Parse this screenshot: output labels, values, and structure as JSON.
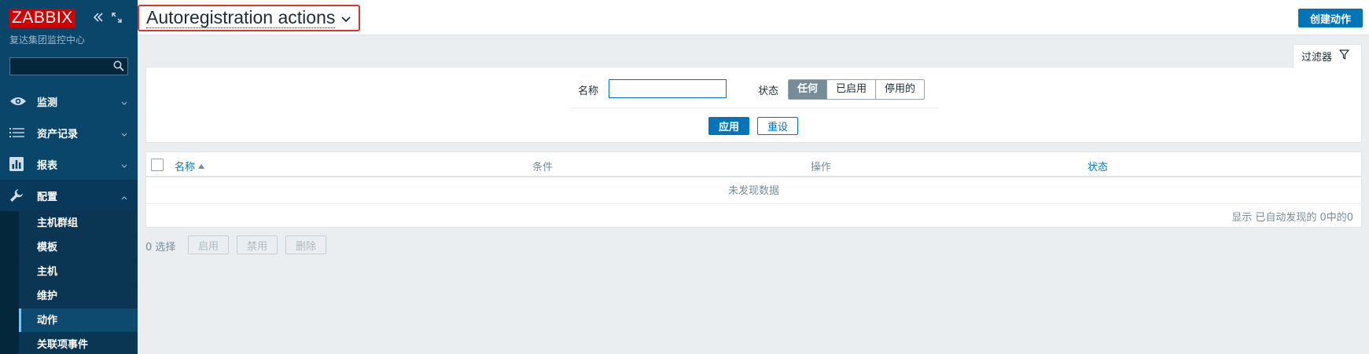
{
  "sidebar": {
    "logo": "ZABBIX",
    "subtitle": "复达集团监控中心",
    "search_value": "",
    "menu": [
      {
        "label": "监测",
        "icon": "eye-icon"
      },
      {
        "label": "资产记录",
        "icon": "list-icon"
      },
      {
        "label": "报表",
        "icon": "bar-chart-icon"
      },
      {
        "label": "配置",
        "icon": "wrench-icon"
      }
    ],
    "config_items": [
      "主机群组",
      "模板",
      "主机",
      "维护",
      "动作",
      "关联项事件"
    ],
    "active_item": "动作"
  },
  "header": {
    "title": "Autoregistration actions",
    "create_button": "创建动作"
  },
  "filter": {
    "tab_label": "过滤器",
    "name_label": "名称",
    "name_value": "",
    "status_label": "状态",
    "status_options": [
      "任何",
      "已启用",
      "停用的"
    ],
    "status_selected": "任何",
    "apply": "应用",
    "reset": "重设"
  },
  "table": {
    "columns": [
      "名称",
      "条件",
      "操作",
      "状态"
    ],
    "sort_column": "名称",
    "empty_text": "未发现数据",
    "pager": "显示 已自动发现的 0中的0"
  },
  "bulk": {
    "selected": "0 选择",
    "enable": "启用",
    "disable": "禁用",
    "delete": "删除"
  },
  "colors": {
    "sidebar_bg": "#0a466a",
    "primary": "#0275b8",
    "logo_red": "#d40000",
    "page_bg": "#ebeef0"
  }
}
